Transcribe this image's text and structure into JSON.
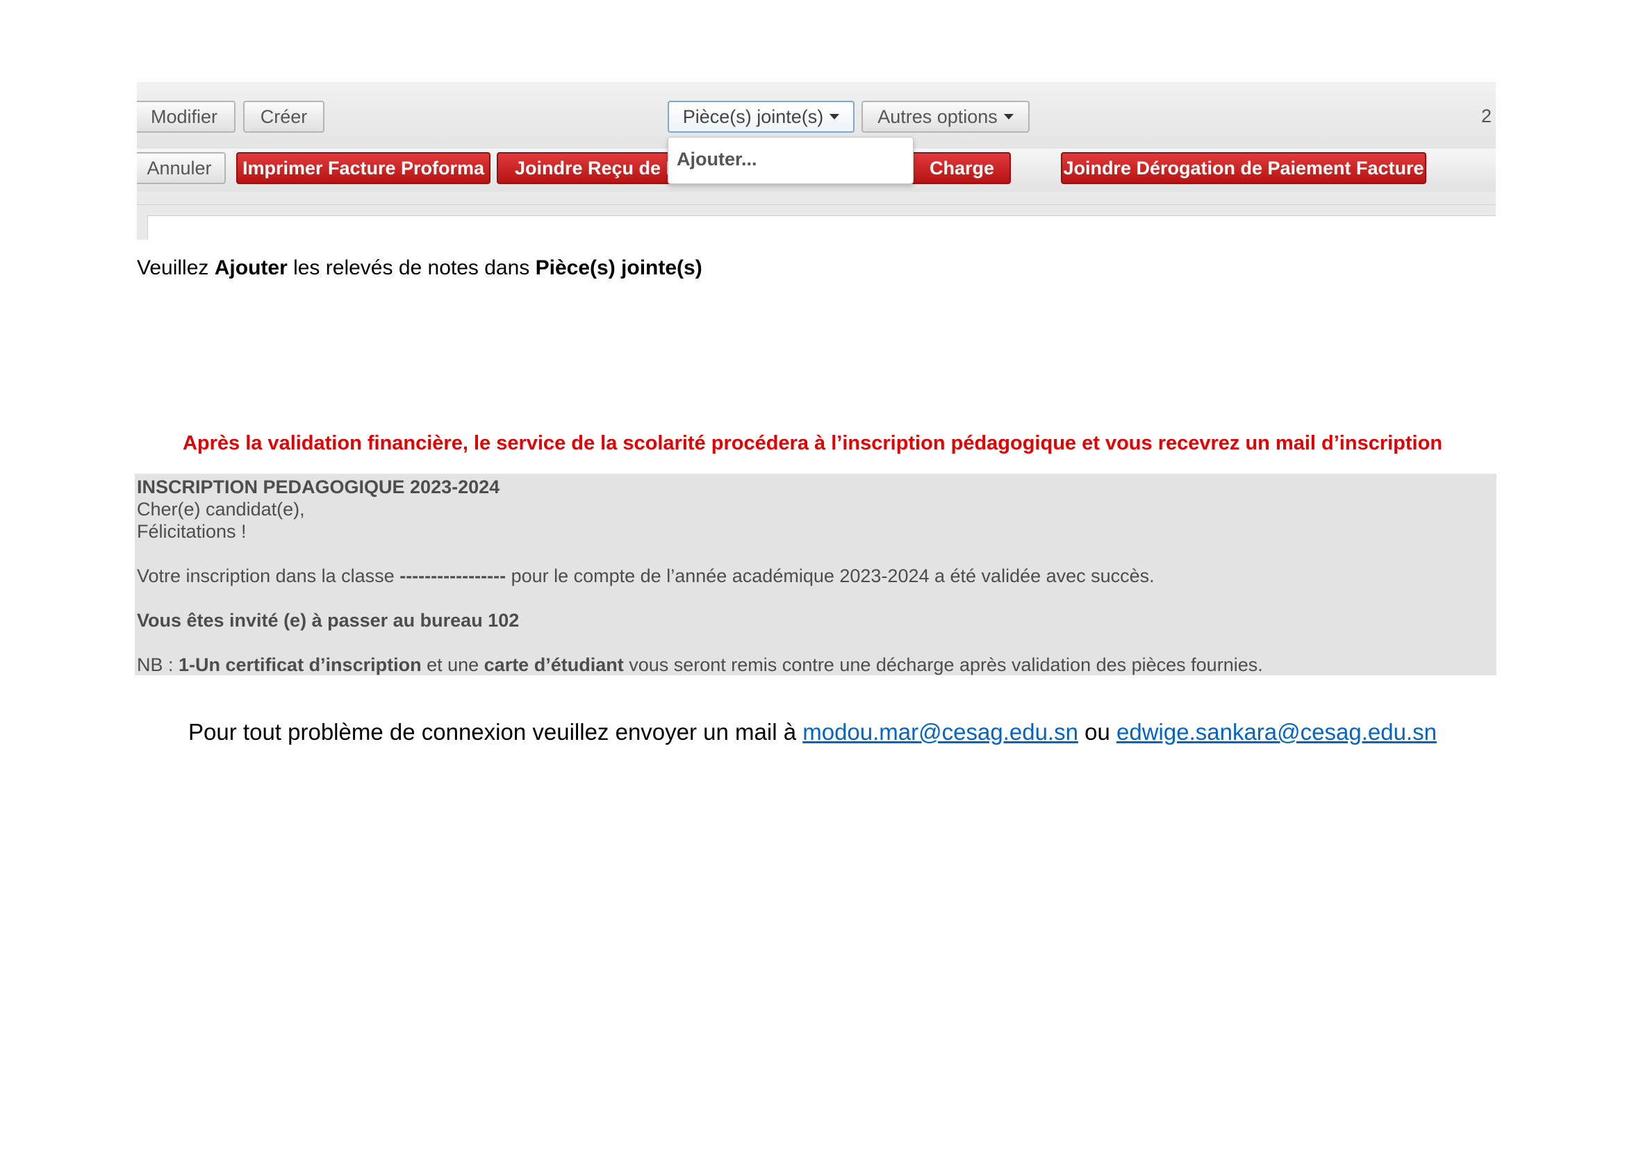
{
  "toolbar": {
    "modifier": "Modifier",
    "creer": "Créer",
    "pieces_jointes": "Pièce(s) jointe(s)",
    "autres_options": "Autres options",
    "date_fragment": "2",
    "annuler": "Annuler",
    "imprimer_facture": "Imprimer Facture Proforma",
    "joindre_recu": "Joindre Reçu de P",
    "charge": "Charge",
    "joindre_derogation": "Joindre Dérogation de Paiement Facture",
    "dropdown_item": "Ajouter..."
  },
  "instruction": {
    "p1": "Veuillez ",
    "b1": "Ajouter",
    "p2": " les relevés de notes dans ",
    "b2": "Pièce(s) jointe(s)"
  },
  "red_note": "Après la validation financière, le service de la scolarité procédera à l’inscription pédagogique et vous recevrez un mail d’inscription",
  "mail": {
    "title": "INSCRIPTION PEDAGOGIQUE 2023-2024",
    "greeting": "Cher(e) candidat(e),",
    "congrats": "Félicitations !",
    "line1_a": "Votre inscription dans la classe ",
    "line1_dashes": "-----------------",
    "line1_b": " pour le compte de l’année académique 2023-2024 a été validée avec succès.",
    "invite": "Vous êtes invité (e) à passer au bureau 102",
    "nb_a": "NB : ",
    "nb_b": "1-Un certificat d’inscription",
    "nb_c": " et une ",
    "nb_d": "carte d’étudiant",
    "nb_e": " vous seront remis contre une décharge après validation des pièces fournies."
  },
  "footer": {
    "text1": "Pour tout problème de connexion veuillez envoyer un mail à ",
    "email1": "modou.mar@cesag.edu.sn",
    "text2": " ou ",
    "email2": "edwige.sankara@cesag.edu.sn"
  },
  "colors": {
    "red_button": "#c41e1e",
    "red_text": "#e00000",
    "link": "#0563c1",
    "mail_bg": "#e3e3e3"
  }
}
